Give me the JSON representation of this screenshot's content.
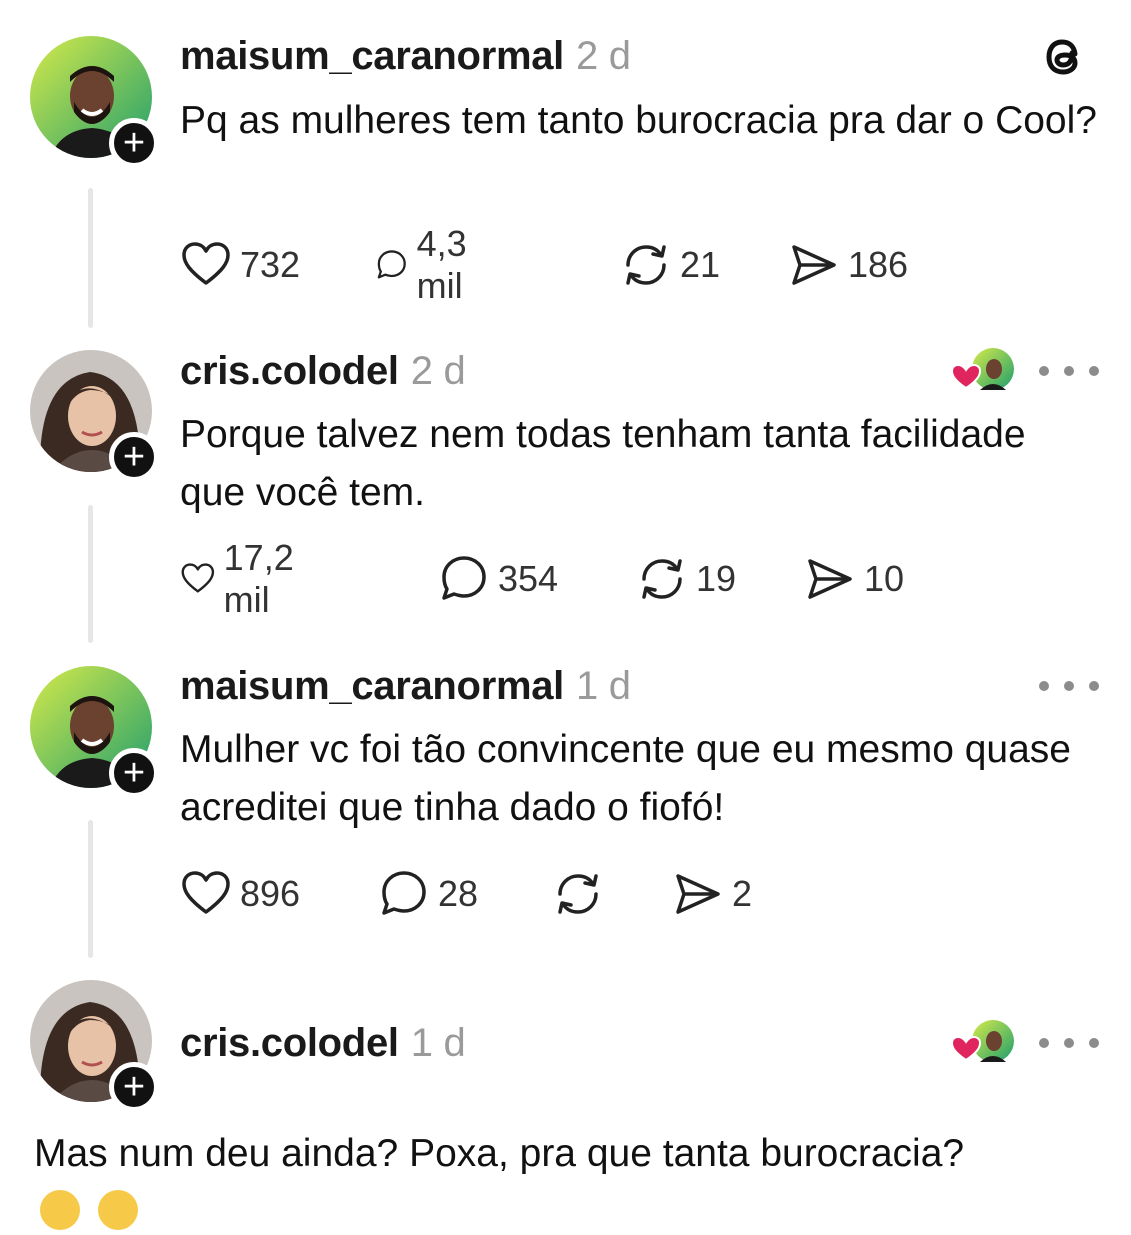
{
  "posts": [
    {
      "username": "maisum_caranormal",
      "time": "2 d",
      "text": "Pq as mulheres tem tanto burocracia pra dar o Cool?",
      "likes": "732",
      "replies": "4,3 mil",
      "reposts": "21",
      "shares": "186",
      "avatar": "man-avatar"
    },
    {
      "username": "cris.colodel",
      "time": "2 d",
      "text": "Porque talvez nem todas tenham tanta facilidade que você tem.",
      "likes": "17,2 mil",
      "replies": "354",
      "reposts": "19",
      "shares": "10",
      "avatar": "woman-avatar"
    },
    {
      "username": "maisum_caranormal",
      "time": "1 d",
      "text": "Mulher vc foi tão convincente que eu mesmo quase acreditei que tinha dado o fiofó!",
      "likes": "896",
      "replies": "28",
      "reposts": "",
      "shares": "2",
      "avatar": "man-avatar"
    },
    {
      "username": "cris.colodel",
      "time": "1 d",
      "text": "Mas num deu ainda? Poxa, pra que tanta burocracia?",
      "avatar": "woman-avatar"
    }
  ],
  "icons": {
    "threads_logo": "threads-logo-icon",
    "like": "heart-icon",
    "reply": "comment-icon",
    "repost": "repost-icon",
    "share": "send-icon",
    "more": "more-dots-icon",
    "follow": "plus-icon"
  },
  "colors": {
    "text": "#111111",
    "muted": "#9a9a9a",
    "like_red": "#e0245e",
    "avatar_gradient_start": "#b6e24a",
    "avatar_gradient_end": "#2aa66a"
  }
}
